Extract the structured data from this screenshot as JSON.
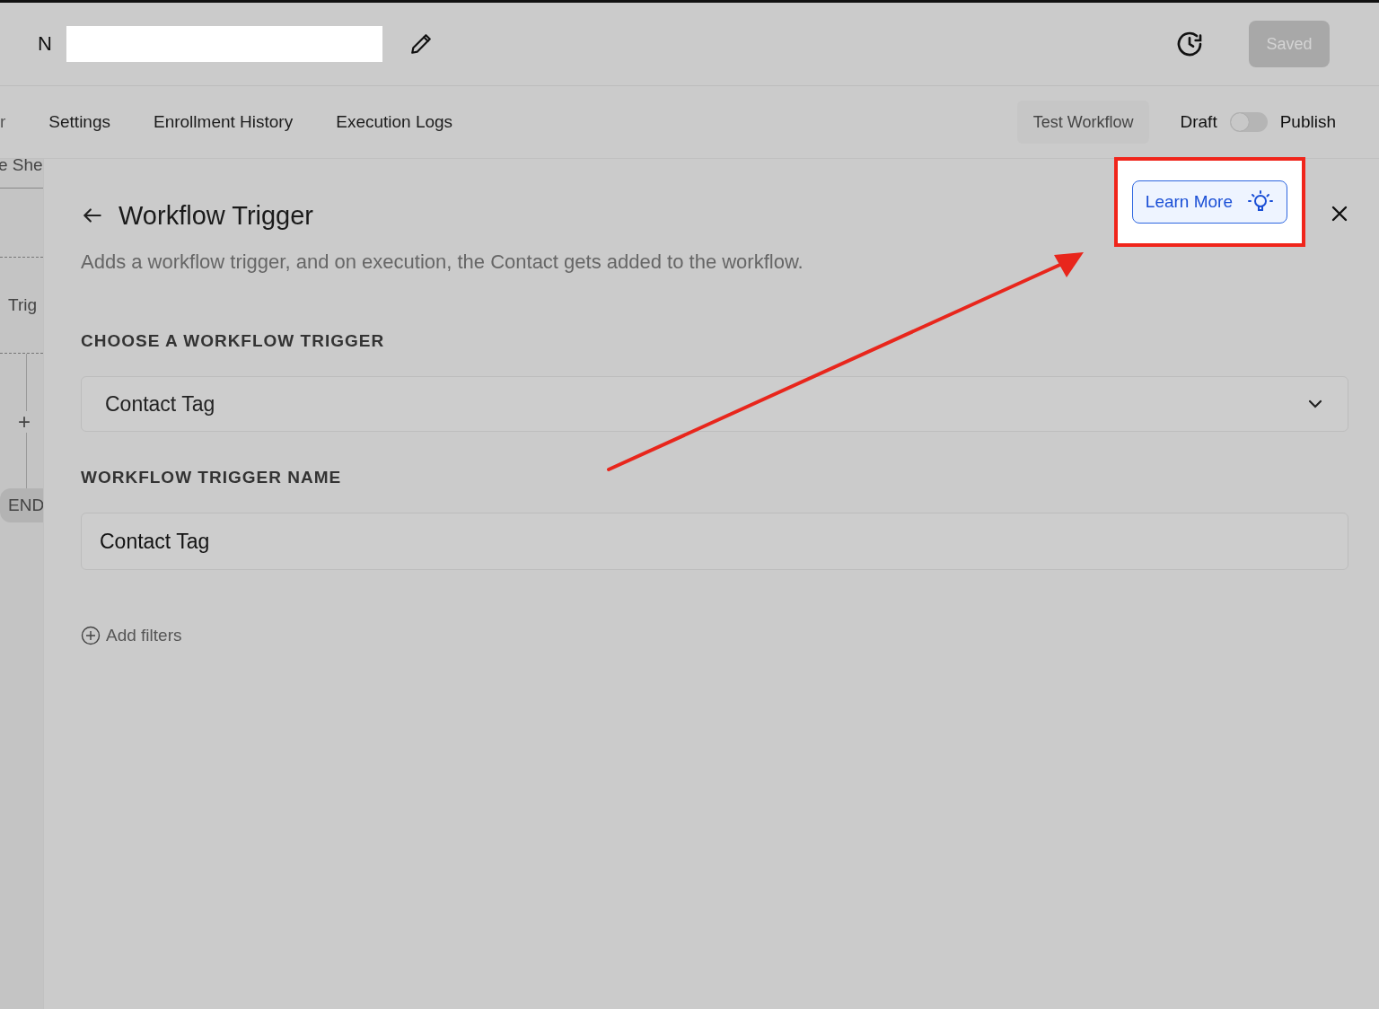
{
  "header": {
    "title": "N",
    "saved_button": "Saved"
  },
  "tabs": [
    "r",
    "Settings",
    "Enrollment History",
    "Execution Logs"
  ],
  "toolbar": {
    "test_button": "Test Workflow",
    "draft_label": "Draft",
    "publish_toggle": {
      "on": false
    },
    "publish_label": "Publish"
  },
  "canvas": {
    "sheet_label": "e She",
    "trigger_label": "Trig",
    "add_symbol": "+",
    "end_label": "END"
  },
  "panel": {
    "title": "Workflow Trigger",
    "learn_more": "Learn More",
    "description": "Adds a workflow trigger, and on execution, the Contact gets added to the workflow.",
    "trigger_section": {
      "label": "CHOOSE A WORKFLOW TRIGGER",
      "value": "Contact Tag"
    },
    "name_section": {
      "label": "WORKFLOW TRIGGER NAME",
      "value": "Contact Tag"
    },
    "add_filters": "Add filters"
  }
}
